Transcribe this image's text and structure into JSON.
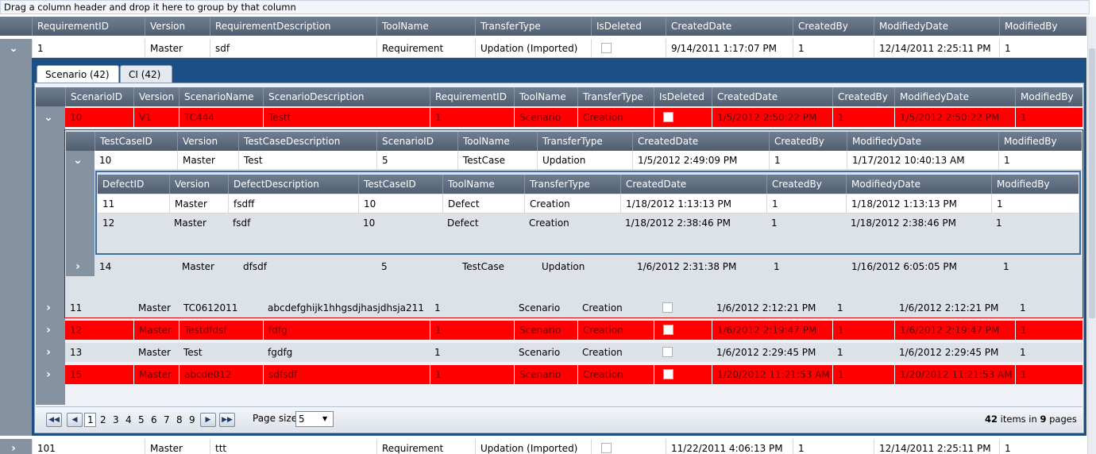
{
  "group_panel_text": "Drag a column header and drop it here to group by that column",
  "req_headers": [
    "RequirementID",
    "Version",
    "RequirementDescription",
    "ToolName",
    "TransferType",
    "IsDeleted",
    "CreatedDate",
    "CreatedBy",
    "ModifiedyDate",
    "ModifiedBy"
  ],
  "req_rows": [
    [
      "1",
      "Master",
      "sdf",
      "Requirement",
      "Updation (Imported)",
      "",
      "9/14/2011 1:17:07 PM",
      "1",
      "12/14/2011 2:25:11 PM",
      "1"
    ],
    [
      "101",
      "Master",
      "ttt",
      "Requirement",
      "Updation (Imported)",
      "",
      "11/22/2011 4:06:13 PM",
      "1",
      "12/14/2011 2:25:11 PM",
      "1"
    ]
  ],
  "tabs": [
    "Scenario (42)",
    "CI (42)"
  ],
  "scen_headers": [
    "ScenarioID",
    "Version",
    "ScenarioName",
    "ScenarioDescription",
    "RequirementID",
    "ToolName",
    "TransferType",
    "IsDeleted",
    "CreatedDate",
    "CreatedBy",
    "ModifiedyDate",
    "ModifiedBy"
  ],
  "scen_rows": [
    [
      "10",
      "V1",
      "TC444",
      "Testt",
      "1",
      "Scenario",
      "Creation",
      "",
      "1/5/2012 2:50:22 PM",
      "1",
      "1/5/2012 2:50:22 PM",
      "1"
    ],
    [
      "11",
      "Master",
      "TC0612011",
      "abcdefghijk1hhgsdjhasjdhsja211",
      "1",
      "Scenario",
      "Creation",
      "",
      "1/6/2012 2:12:21 PM",
      "1",
      "1/6/2012 2:12:21 PM",
      "1"
    ],
    [
      "12",
      "Master",
      "Testdfdsf",
      "fdfg",
      "1",
      "Scenario",
      "Creation",
      "",
      "1/6/2012 2:19:47 PM",
      "1",
      "1/6/2012 2:19:47 PM",
      "1"
    ],
    [
      "13",
      "Master",
      "Test",
      "fgdfg",
      "1",
      "Scenario",
      "Creation",
      "",
      "1/6/2012 2:29:45 PM",
      "1",
      "1/6/2012 2:29:45 PM",
      "1"
    ],
    [
      "15",
      "Master",
      "abcde012",
      "sdfsdf",
      "1",
      "Scenario",
      "Creation",
      "",
      "1/20/2012 11:21:53 AM",
      "1",
      "1/20/2012 11:21:53 AM",
      "1"
    ]
  ],
  "tc_headers": [
    "TestCaseID",
    "Version",
    "TestCaseDescription",
    "ScenarioID",
    "ToolName",
    "TransferType",
    "CreatedDate",
    "CreatedBy",
    "ModifiedyDate",
    "ModifiedBy"
  ],
  "tc_rows": [
    [
      "10",
      "Master",
      "Test",
      "5",
      "TestCase",
      "Updation",
      "1/5/2012 2:49:09 PM",
      "1",
      "1/17/2012 10:40:13 AM",
      "1"
    ],
    [
      "14",
      "Master",
      "dfsdf",
      "5",
      "TestCase",
      "Updation",
      "1/6/2012 2:31:38 PM",
      "1",
      "1/16/2012 6:05:05 PM",
      "1"
    ]
  ],
  "def_headers": [
    "DefectID",
    "Version",
    "DefectDescription",
    "TestCaseID",
    "ToolName",
    "TransferType",
    "CreatedDate",
    "CreatedBy",
    "ModifiedyDate",
    "ModifiedBy"
  ],
  "def_rows": [
    [
      "11",
      "Master",
      "fsdff",
      "10",
      "Defect",
      "Creation",
      "1/18/2012 1:13:13 PM",
      "1",
      "1/18/2012 1:13:13 PM",
      "1"
    ],
    [
      "12",
      "Master",
      "fsdf",
      "10",
      "Defect",
      "Creation",
      "1/18/2012 2:38:46 PM",
      "1",
      "1/18/2012 2:38:46 PM",
      "1"
    ]
  ],
  "pager": {
    "pages": [
      "1",
      "2",
      "3",
      "4",
      "5",
      "6",
      "7",
      "8",
      "9"
    ],
    "page_size_label": "Page size:",
    "page_size_value": "5",
    "items_count": "42",
    "items_text": "items in",
    "pages_count": "9",
    "pages_text": "pages"
  },
  "colors": {
    "header": "#5c6b7d",
    "highlight": "#ff0000",
    "band": "#1c4f86"
  }
}
